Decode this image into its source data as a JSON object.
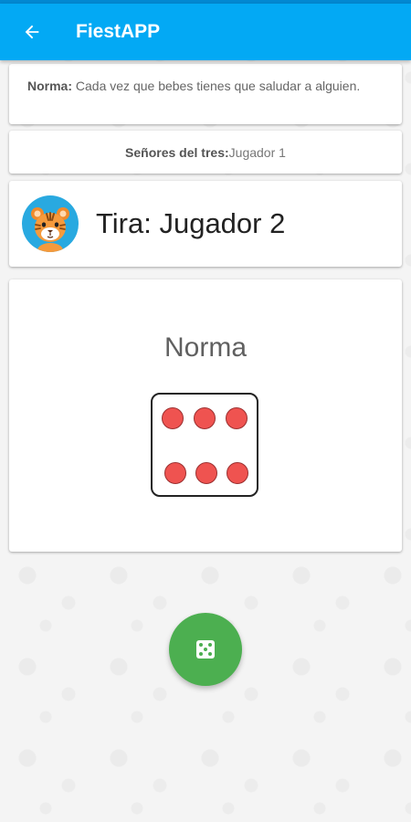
{
  "app_bar": {
    "title": "FiestAPP",
    "back_icon": "arrow-back-icon",
    "color": "#03a9f4"
  },
  "rule": {
    "player_label": "Norma:",
    "text": " Cada vez que bebes tienes que saludar a alguien."
  },
  "group": {
    "label": "Señores del tres:",
    "value": " Jugador 1"
  },
  "turn": {
    "text": "Tira: Jugador 2",
    "avatar_icon": "tiger-avatar-icon"
  },
  "dice": {
    "player": "Norma",
    "value": 6,
    "pip_color": "#ef5350"
  },
  "roll_button": {
    "icon": "dice-icon",
    "color": "#4caf50"
  }
}
